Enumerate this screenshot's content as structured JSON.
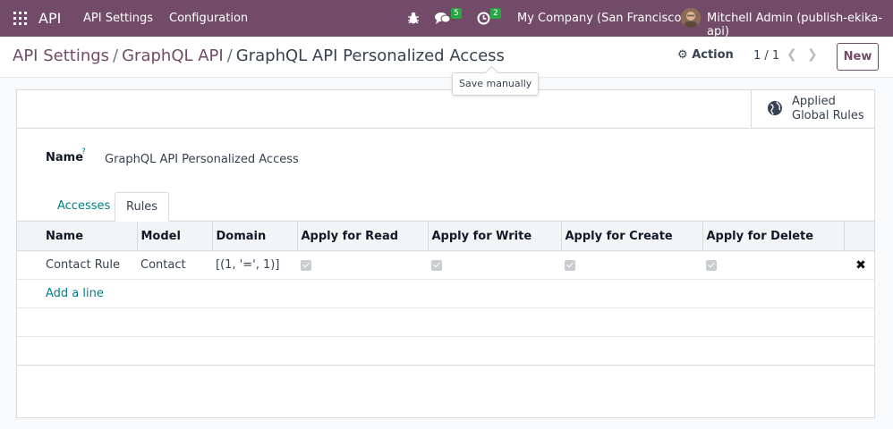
{
  "navbar": {
    "app_name": "API",
    "menu": [
      "API Settings",
      "Configuration"
    ],
    "messages_count": "5",
    "activities_count": "2",
    "company": "My Company (San Francisco)",
    "user": "Mitchell Admin (publish-ekika-api)"
  },
  "control_panel": {
    "breadcrumb": [
      "API Settings",
      "GraphQL API",
      "GraphQL API Personalized Access"
    ],
    "action_label": "Action",
    "pager": "1 / 1",
    "new_label": "New",
    "tooltip": "Save manually"
  },
  "form": {
    "stat_button": {
      "line1": "Applied",
      "line2": "Global Rules"
    },
    "name_label": "Name",
    "name_help": "?",
    "name_value": "GraphQL API Personalized Access",
    "tabs": [
      "Accesses",
      "Rules"
    ],
    "active_tab": "Rules",
    "table": {
      "columns": [
        "Name",
        "Model",
        "Domain",
        "Apply for Read",
        "Apply for Write",
        "Apply for Create",
        "Apply for Delete"
      ],
      "rows": [
        {
          "name": "Contact Rule",
          "model": "Contact",
          "domain": "[(1, '=', 1)]",
          "read": true,
          "write": true,
          "create": true,
          "delete": true
        }
      ],
      "add_line": "Add a line"
    }
  },
  "colors": {
    "brand": "#714b67",
    "link": "#017e84",
    "badge": "#28a745"
  }
}
